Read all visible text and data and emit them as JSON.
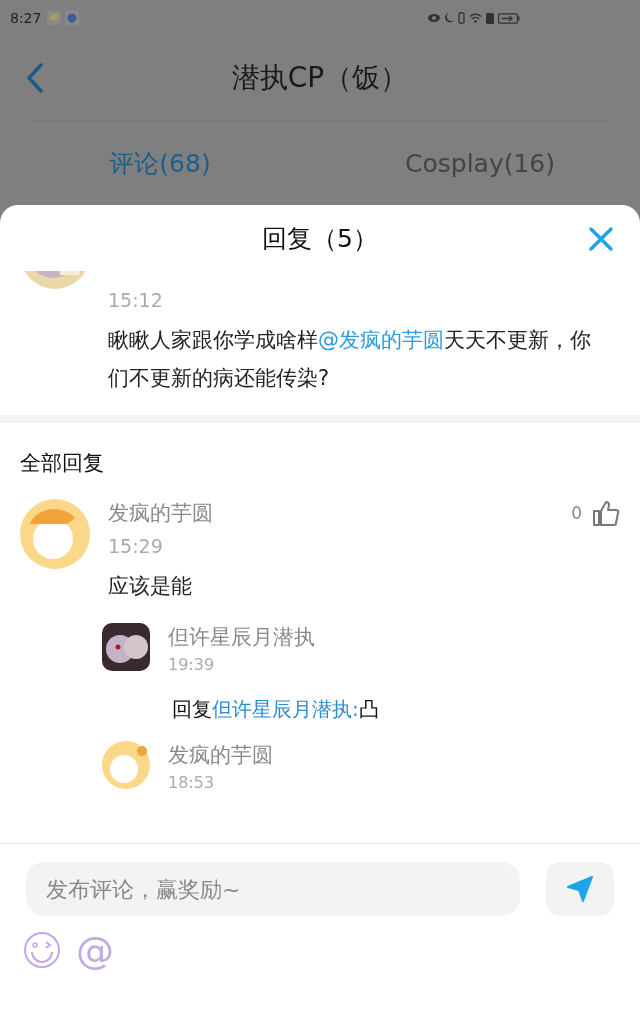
{
  "status_bar": {
    "time": "8:27"
  },
  "header": {
    "title": "潜执CP（饭）"
  },
  "tabs": [
    {
      "label": "评论(68)",
      "selected": true
    },
    {
      "label": "Cosplay(16)",
      "selected": false
    }
  ],
  "sheet": {
    "title": "回复（5）",
    "original_comment": {
      "time": "15:12",
      "parts": [
        {
          "kind": "plain",
          "text": "瞅瞅人家跟你学成啥样"
        },
        {
          "kind": "mention",
          "text": "@发疯的芋圆"
        },
        {
          "kind": "plain",
          "text": "天天不更新，你们不更新的病还能传染?"
        }
      ]
    },
    "section_title": "全部回复",
    "reply": {
      "author": "发疯的芋圆",
      "time": "15:29",
      "likes": "0",
      "text": "应该是能",
      "children": [
        {
          "author": "但许星辰月潜执",
          "time": "19:39",
          "parts": [
            {
              "kind": "plain",
              "text": "回复"
            },
            {
              "kind": "mention",
              "text": "但许星辰月潜执:"
            },
            {
              "kind": "plain",
              "text": "凸"
            }
          ]
        },
        {
          "author": "发疯的芋圆",
          "time": "18:53"
        }
      ]
    }
  },
  "composer": {
    "placeholder": "发布评论，赢奖励~",
    "mention_symbol": "@"
  }
}
